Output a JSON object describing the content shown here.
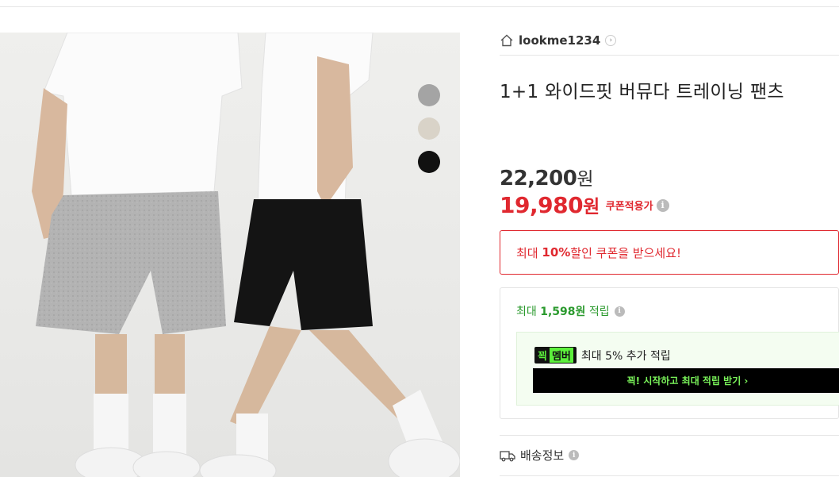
{
  "store": {
    "name": "lookme1234",
    "arrow": "›"
  },
  "product": {
    "title": "1+1 와이드핏 버뮤다 트레이닝 팬츠"
  },
  "price": {
    "original": "22,200",
    "original_unit": "원",
    "sale": "19,980",
    "sale_unit": "원",
    "coupon_label": "쿠폰적용가"
  },
  "coupon_box": {
    "prefix": "최대 ",
    "percent": "10%",
    "suffix": " 할인 쿠폰을 받으세요!"
  },
  "reward": {
    "prefix": "최대 ",
    "amount": "1,598원",
    "suffix": " 적립",
    "member_badge_a": "꾁",
    "member_badge_b": "멤버",
    "member_text": "최대 5% 추가 적립",
    "member_button": "꾁! 시작하고 최대 적립 받기 ›"
  },
  "shipping": {
    "label": "배송정보"
  },
  "swatches": [
    {
      "name": "gray",
      "color": "#a4a4a4"
    },
    {
      "name": "beige",
      "color": "#d9d3c8"
    },
    {
      "name": "black",
      "color": "#111111"
    }
  ],
  "colors": {
    "accent_red": "#e0282f",
    "reward_green": "#2b9a2e",
    "member_green": "#5cf03c"
  }
}
